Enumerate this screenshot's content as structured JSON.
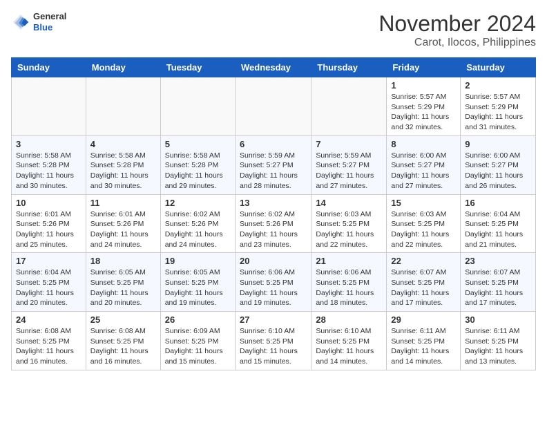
{
  "header": {
    "logo_line1": "General",
    "logo_line2": "Blue",
    "title": "November 2024",
    "subtitle": "Carot, Ilocos, Philippines"
  },
  "days_of_week": [
    "Sunday",
    "Monday",
    "Tuesday",
    "Wednesday",
    "Thursday",
    "Friday",
    "Saturday"
  ],
  "weeks": [
    [
      {
        "day": "",
        "info": ""
      },
      {
        "day": "",
        "info": ""
      },
      {
        "day": "",
        "info": ""
      },
      {
        "day": "",
        "info": ""
      },
      {
        "day": "",
        "info": ""
      },
      {
        "day": "1",
        "info": "Sunrise: 5:57 AM\nSunset: 5:29 PM\nDaylight: 11 hours and 32 minutes."
      },
      {
        "day": "2",
        "info": "Sunrise: 5:57 AM\nSunset: 5:29 PM\nDaylight: 11 hours and 31 minutes."
      }
    ],
    [
      {
        "day": "3",
        "info": "Sunrise: 5:58 AM\nSunset: 5:28 PM\nDaylight: 11 hours and 30 minutes."
      },
      {
        "day": "4",
        "info": "Sunrise: 5:58 AM\nSunset: 5:28 PM\nDaylight: 11 hours and 30 minutes."
      },
      {
        "day": "5",
        "info": "Sunrise: 5:58 AM\nSunset: 5:28 PM\nDaylight: 11 hours and 29 minutes."
      },
      {
        "day": "6",
        "info": "Sunrise: 5:59 AM\nSunset: 5:27 PM\nDaylight: 11 hours and 28 minutes."
      },
      {
        "day": "7",
        "info": "Sunrise: 5:59 AM\nSunset: 5:27 PM\nDaylight: 11 hours and 27 minutes."
      },
      {
        "day": "8",
        "info": "Sunrise: 6:00 AM\nSunset: 5:27 PM\nDaylight: 11 hours and 27 minutes."
      },
      {
        "day": "9",
        "info": "Sunrise: 6:00 AM\nSunset: 5:27 PM\nDaylight: 11 hours and 26 minutes."
      }
    ],
    [
      {
        "day": "10",
        "info": "Sunrise: 6:01 AM\nSunset: 5:26 PM\nDaylight: 11 hours and 25 minutes."
      },
      {
        "day": "11",
        "info": "Sunrise: 6:01 AM\nSunset: 5:26 PM\nDaylight: 11 hours and 24 minutes."
      },
      {
        "day": "12",
        "info": "Sunrise: 6:02 AM\nSunset: 5:26 PM\nDaylight: 11 hours and 24 minutes."
      },
      {
        "day": "13",
        "info": "Sunrise: 6:02 AM\nSunset: 5:26 PM\nDaylight: 11 hours and 23 minutes."
      },
      {
        "day": "14",
        "info": "Sunrise: 6:03 AM\nSunset: 5:25 PM\nDaylight: 11 hours and 22 minutes."
      },
      {
        "day": "15",
        "info": "Sunrise: 6:03 AM\nSunset: 5:25 PM\nDaylight: 11 hours and 22 minutes."
      },
      {
        "day": "16",
        "info": "Sunrise: 6:04 AM\nSunset: 5:25 PM\nDaylight: 11 hours and 21 minutes."
      }
    ],
    [
      {
        "day": "17",
        "info": "Sunrise: 6:04 AM\nSunset: 5:25 PM\nDaylight: 11 hours and 20 minutes."
      },
      {
        "day": "18",
        "info": "Sunrise: 6:05 AM\nSunset: 5:25 PM\nDaylight: 11 hours and 20 minutes."
      },
      {
        "day": "19",
        "info": "Sunrise: 6:05 AM\nSunset: 5:25 PM\nDaylight: 11 hours and 19 minutes."
      },
      {
        "day": "20",
        "info": "Sunrise: 6:06 AM\nSunset: 5:25 PM\nDaylight: 11 hours and 19 minutes."
      },
      {
        "day": "21",
        "info": "Sunrise: 6:06 AM\nSunset: 5:25 PM\nDaylight: 11 hours and 18 minutes."
      },
      {
        "day": "22",
        "info": "Sunrise: 6:07 AM\nSunset: 5:25 PM\nDaylight: 11 hours and 17 minutes."
      },
      {
        "day": "23",
        "info": "Sunrise: 6:07 AM\nSunset: 5:25 PM\nDaylight: 11 hours and 17 minutes."
      }
    ],
    [
      {
        "day": "24",
        "info": "Sunrise: 6:08 AM\nSunset: 5:25 PM\nDaylight: 11 hours and 16 minutes."
      },
      {
        "day": "25",
        "info": "Sunrise: 6:08 AM\nSunset: 5:25 PM\nDaylight: 11 hours and 16 minutes."
      },
      {
        "day": "26",
        "info": "Sunrise: 6:09 AM\nSunset: 5:25 PM\nDaylight: 11 hours and 15 minutes."
      },
      {
        "day": "27",
        "info": "Sunrise: 6:10 AM\nSunset: 5:25 PM\nDaylight: 11 hours and 15 minutes."
      },
      {
        "day": "28",
        "info": "Sunrise: 6:10 AM\nSunset: 5:25 PM\nDaylight: 11 hours and 14 minutes."
      },
      {
        "day": "29",
        "info": "Sunrise: 6:11 AM\nSunset: 5:25 PM\nDaylight: 11 hours and 14 minutes."
      },
      {
        "day": "30",
        "info": "Sunrise: 6:11 AM\nSunset: 5:25 PM\nDaylight: 11 hours and 13 minutes."
      }
    ]
  ]
}
